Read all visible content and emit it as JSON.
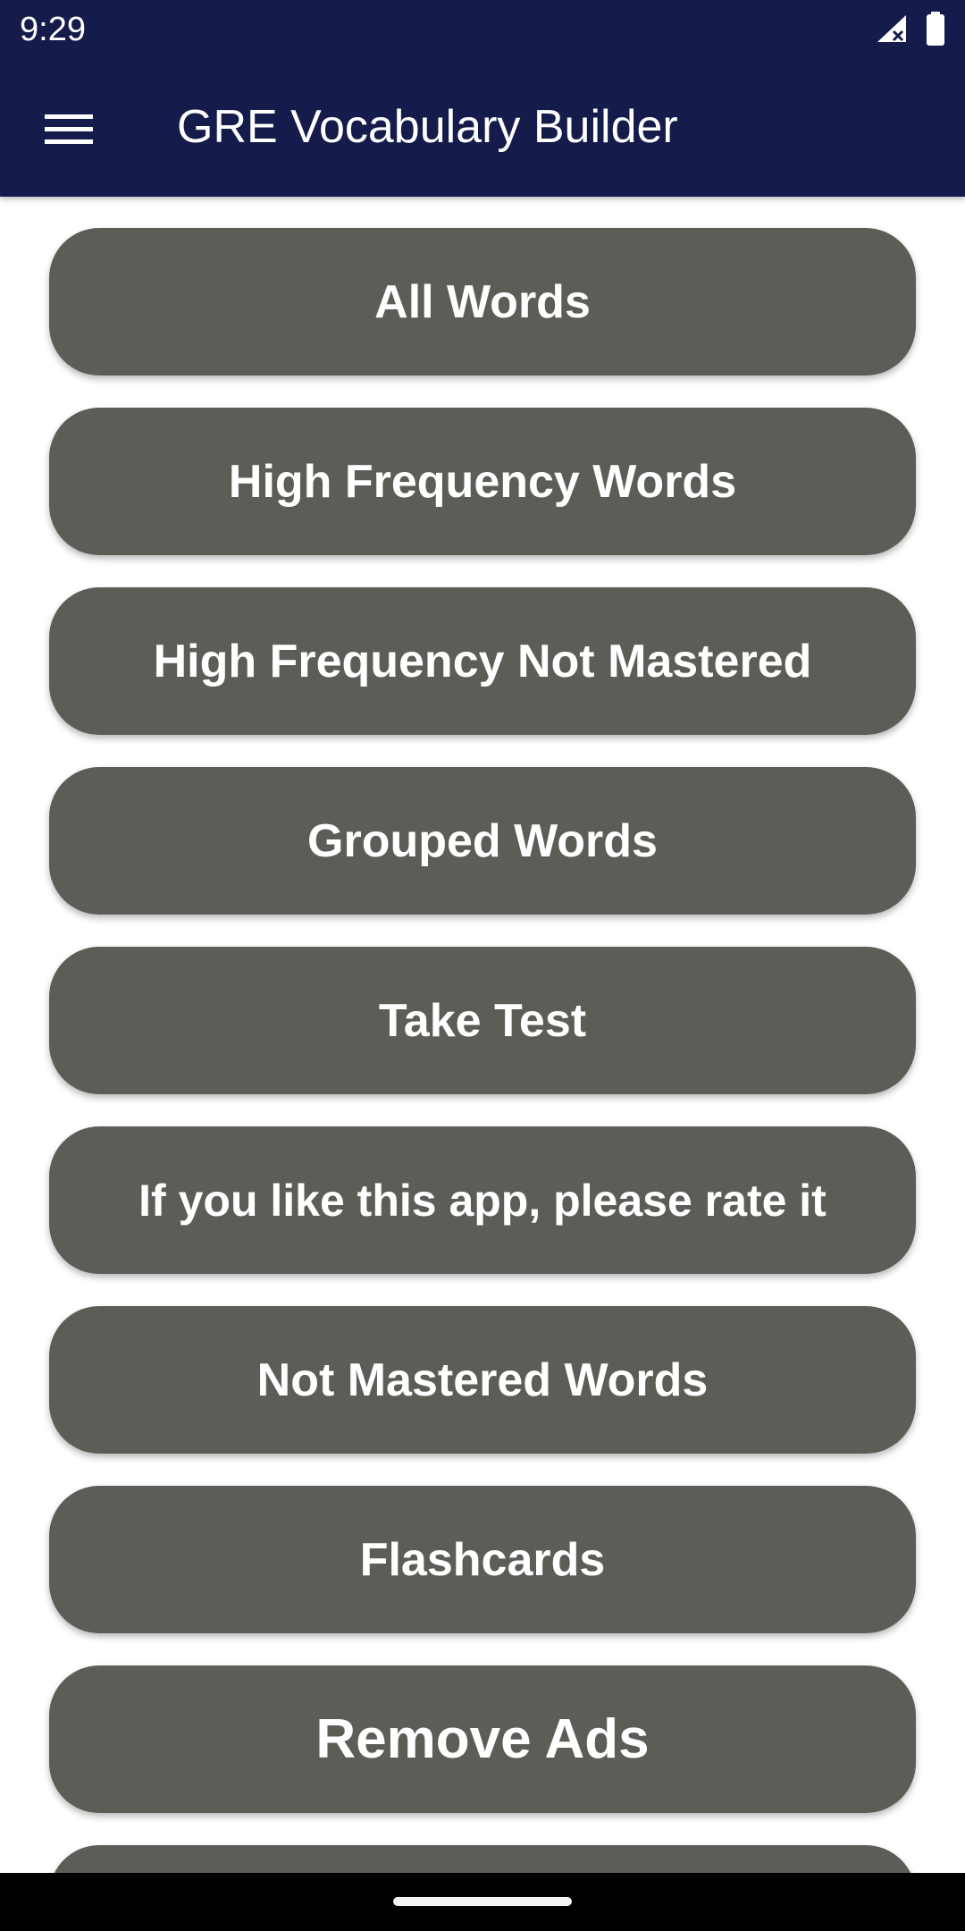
{
  "colors": {
    "app_bar": "#151c4b",
    "button": "#5d5c57",
    "text": "#ffffff"
  },
  "status_bar": {
    "time": "9:29",
    "icons": [
      "signal-icon",
      "battery-icon"
    ]
  },
  "app_bar": {
    "menu_icon": "hamburger-menu-icon",
    "title": "GRE Vocabulary Builder"
  },
  "menu": {
    "items": [
      {
        "label": "All Words"
      },
      {
        "label": "High Frequency Words"
      },
      {
        "label": "High Frequency Not Mastered"
      },
      {
        "label": "Grouped Words"
      },
      {
        "label": "Take Test"
      },
      {
        "label": "If you like this app, please rate it"
      },
      {
        "label": "Not Mastered Words"
      },
      {
        "label": "Flashcards"
      },
      {
        "label": "Remove Ads"
      },
      {
        "label": ""
      }
    ]
  }
}
